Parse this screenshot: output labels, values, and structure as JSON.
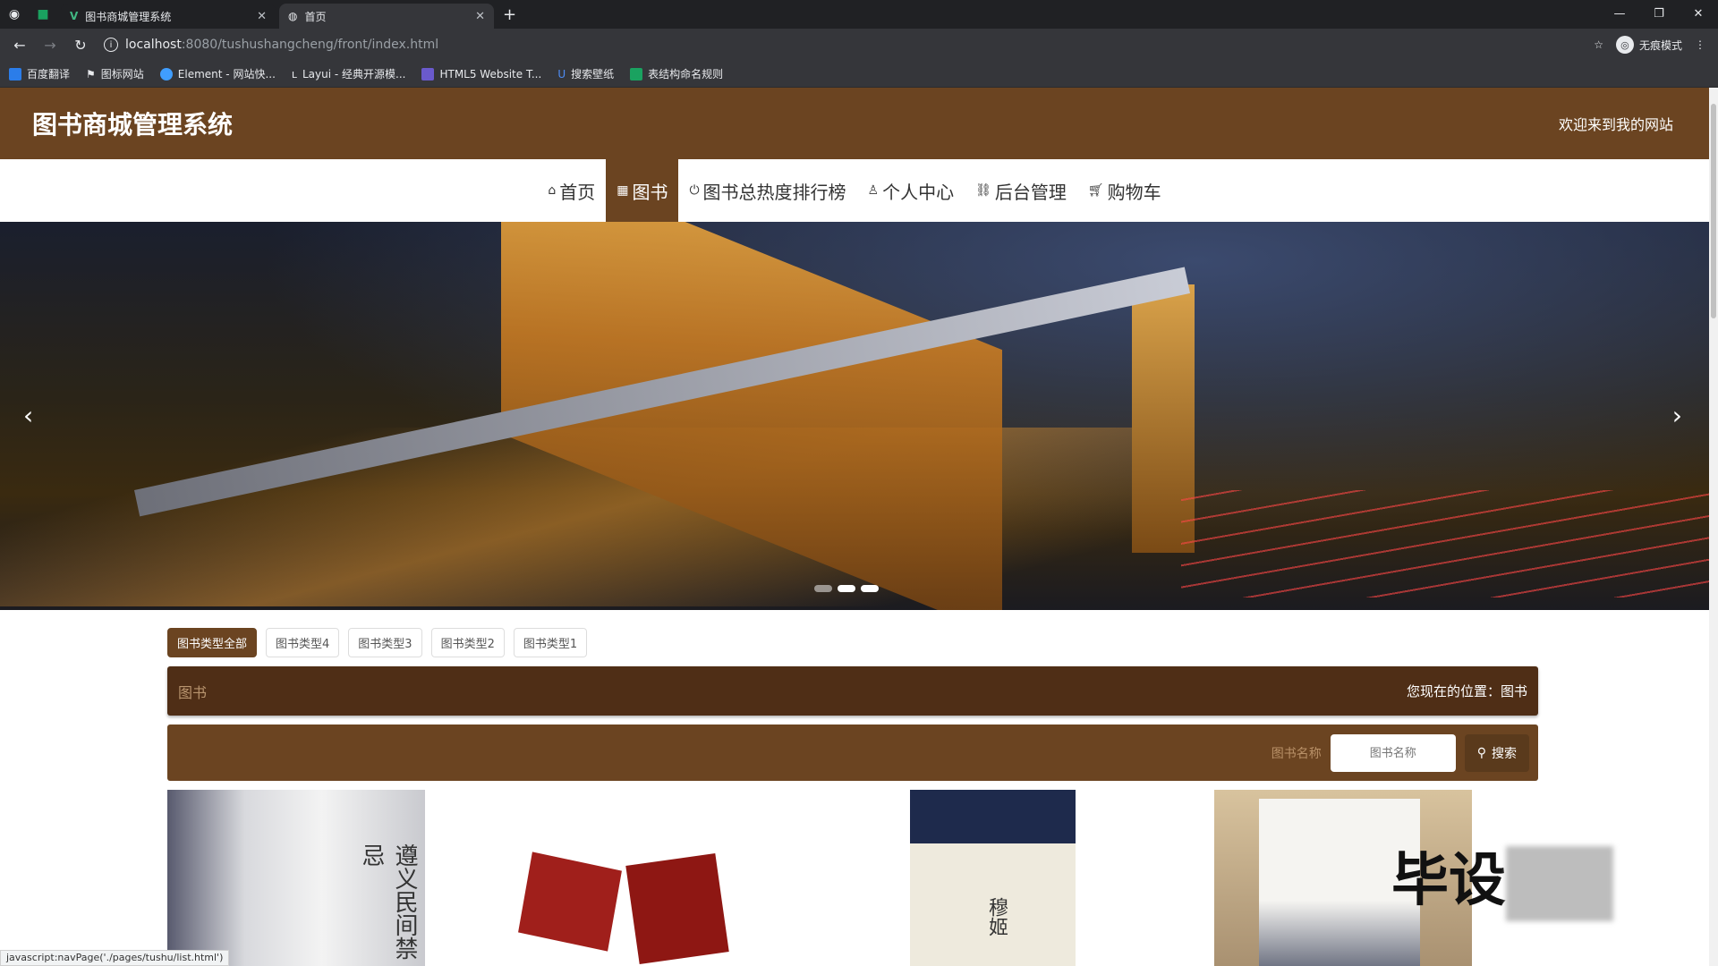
{
  "browser": {
    "tabs": [
      {
        "title": "图书商城管理系统",
        "active": false
      },
      {
        "title": "首页",
        "active": true
      }
    ],
    "new_tab": "+",
    "url_host": "localhost",
    "url_rest": ":8080/tushushangcheng/front/index.html",
    "profile_label": "无痕模式",
    "bookmarks": [
      "百度翻译",
      "图标网站",
      "Element - 网站快...",
      "Layui - 经典开源模...",
      "HTML5 Website T...",
      "搜索壁纸",
      "表结构命名规则"
    ],
    "status_text": "javascript:navPage('./pages/tushu/list.html')"
  },
  "site": {
    "title": "图书商城管理系统",
    "welcome": "欢迎来到我的网站"
  },
  "nav": {
    "items": [
      {
        "label": "首页",
        "icon": "home-icon",
        "active": false
      },
      {
        "label": "图书",
        "icon": "grid-icon",
        "active": true
      },
      {
        "label": "图书总热度排行榜",
        "icon": "power-icon",
        "active": false
      },
      {
        "label": "个人中心",
        "icon": "user-icon",
        "active": false
      },
      {
        "label": "后台管理",
        "icon": "link-icon",
        "active": false
      },
      {
        "label": "购物车",
        "icon": "cart-icon",
        "active": false
      }
    ]
  },
  "carousel": {
    "slides": 3,
    "active_index": 1
  },
  "categories": [
    {
      "label": "图书类型全部",
      "active": true
    },
    {
      "label": "图书类型4",
      "active": false
    },
    {
      "label": "图书类型3",
      "active": false
    },
    {
      "label": "图书类型2",
      "active": false
    },
    {
      "label": "图书类型1",
      "active": false
    }
  ],
  "crumb": {
    "title": "图书",
    "location": "您现在的位置：图书"
  },
  "search": {
    "label": "图书名称",
    "placeholder": "图书名称",
    "button": "搜索"
  },
  "books": {
    "b1_title": "遵义民间禁忌",
    "b3_title": "穆姬"
  },
  "watermark": "毕设",
  "colors": {
    "brand": "#6b4421",
    "crumb_bg": "#4f2e16"
  }
}
